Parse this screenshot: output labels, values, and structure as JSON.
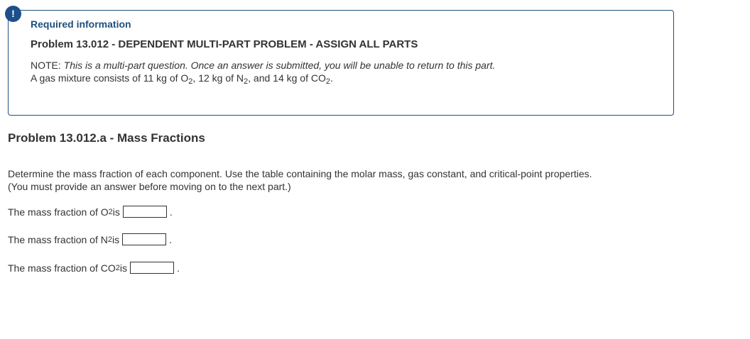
{
  "alert": {
    "symbol": "!"
  },
  "info": {
    "required": "Required information",
    "problem_title": "Problem 13.012 - DEPENDENT MULTI-PART PROBLEM - ASSIGN ALL PARTS",
    "note_label": "NOTE:",
    "note_text": "This is a multi-part question. Once an answer is submitted, you will be unable to return to this part.",
    "desc_prefix": "A gas mixture consists of 11 kg of O",
    "desc_o2_sub": "2",
    "desc_mid1": ", 12 kg of N",
    "desc_n2_sub": "2",
    "desc_mid2": ", and 14 kg of CO",
    "desc_co2_sub": "2",
    "desc_end": "."
  },
  "part": {
    "title": "Problem 13.012.a - Mass Fractions",
    "instruction_line1": "Determine the mass fraction of each component. Use the table containing the molar mass, gas constant, and critical-point properties.",
    "instruction_line2": "(You must provide an answer before moving on to the next part.)"
  },
  "questions": [
    {
      "prefix": "The mass fraction of O",
      "sub": "2",
      "suffix": " is",
      "value": "",
      "end": "."
    },
    {
      "prefix": "The mass fraction of N",
      "sub": "2",
      "suffix": " is",
      "value": "",
      "end": "."
    },
    {
      "prefix": "The mass fraction of CO",
      "sub": "2",
      "suffix": " is",
      "value": "",
      "end": "."
    }
  ]
}
